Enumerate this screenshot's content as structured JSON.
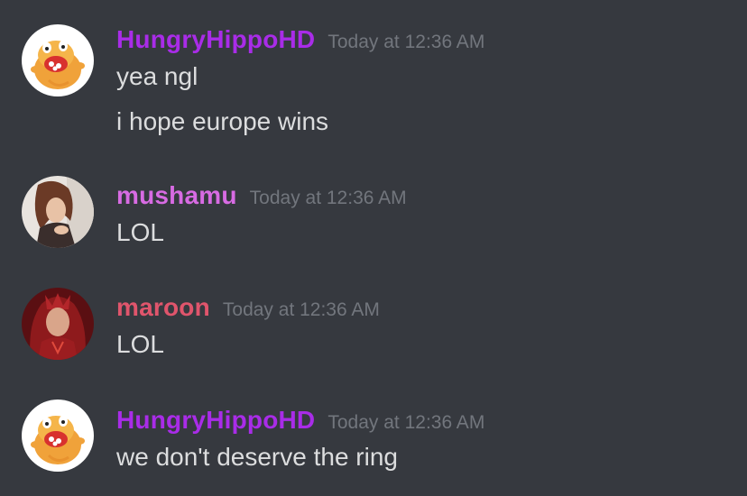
{
  "colors": {
    "background": "#36393f",
    "timestamp": "#72767d",
    "message_text": "#dcddde"
  },
  "messages": [
    {
      "username": "HungryHippoHD",
      "username_color": "#a92ce8",
      "avatar_icon": "hippo-avatar-icon",
      "timestamp": "Today at 12:36 AM",
      "lines": [
        "yea ngl",
        "i hope europe wins"
      ]
    },
    {
      "username": "mushamu",
      "username_color": "#d86be3",
      "avatar_icon": "woman-portrait-avatar-icon",
      "timestamp": "Today at 12:36 AM",
      "lines": [
        "LOL"
      ]
    },
    {
      "username": "maroon",
      "username_color": "#e0556c",
      "avatar_icon": "scarlet-witch-avatar-icon",
      "timestamp": "Today at 12:36 AM",
      "lines": [
        "LOL"
      ]
    },
    {
      "username": "HungryHippoHD",
      "username_color": "#a92ce8",
      "avatar_icon": "hippo-avatar-icon",
      "timestamp": "Today at 12:36 AM",
      "lines": [
        "we don't deserve the ring"
      ]
    }
  ]
}
